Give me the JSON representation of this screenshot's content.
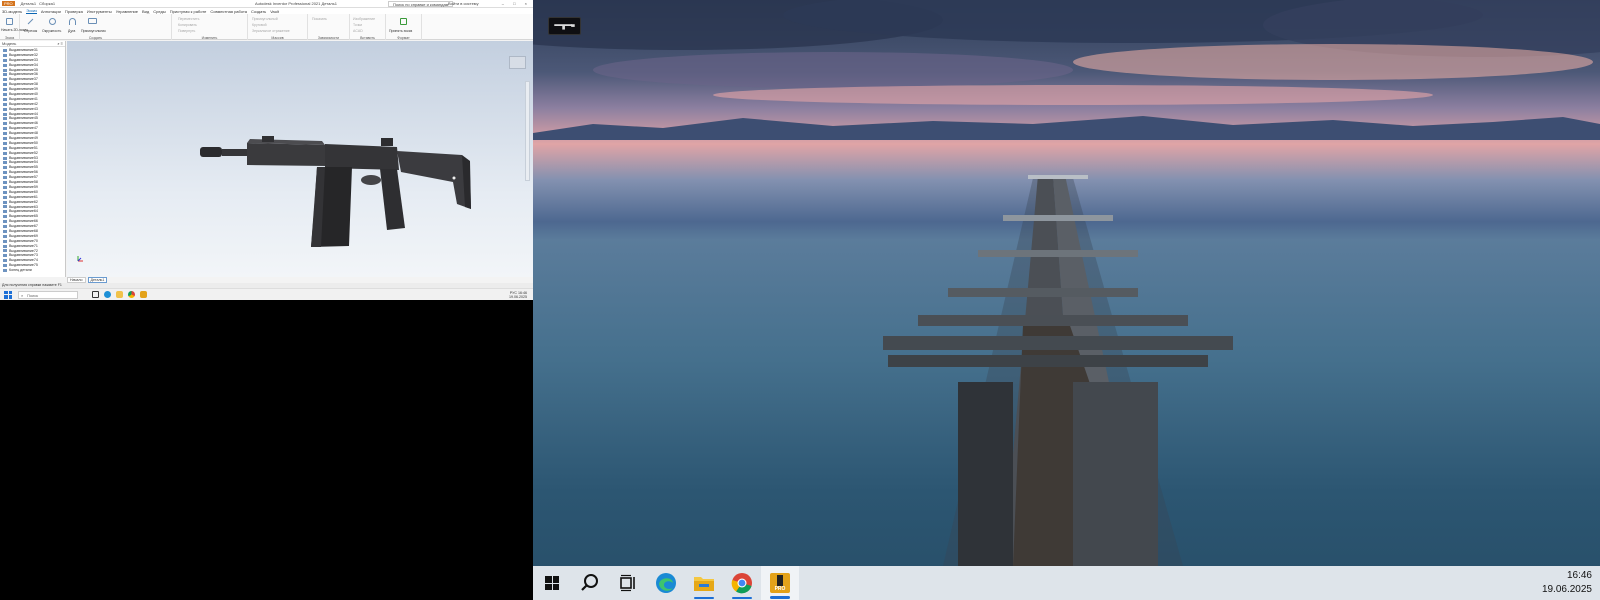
{
  "left_monitor": {
    "inventor": {
      "title_badge": "PRO",
      "title_tabs": [
        "Деталь1",
        "Сборка1"
      ],
      "title_center": "Autodesk Inventor Professional 2021   Деталь1",
      "search_placeholder": "Поиск по справке и командам",
      "user": "Войти в систему",
      "window_controls": "– □ ×",
      "ribbon_tabs": [
        "3D-модель",
        "Эскиз",
        "Аннотации",
        "Проверка",
        "Инструменты",
        "Управление",
        "Вид",
        "Среды",
        "Приступая к работе",
        "Совместная работа",
        "Создать",
        "Vault"
      ],
      "ribbon_active_tab": "Эскиз",
      "ribbon_groups": [
        {
          "label": "Эскиз",
          "buttons": [
            "Начать 2D-эскиз"
          ]
        },
        {
          "label": "Создать",
          "buttons": [
            "Отрезок",
            "Окружность",
            "Дуга",
            "Прямоугольник"
          ]
        },
        {
          "label": "Изменить",
          "buttons": [
            "Переместить",
            "Копировать",
            "Повернуть"
          ]
        },
        {
          "label": "Массив",
          "buttons": [
            "Прямоугольный",
            "Круговой",
            "Зеркальное отражение"
          ]
        },
        {
          "label": "Зависимости",
          "buttons": [
            "Показать"
          ]
        },
        {
          "label": "Вставить",
          "buttons": [
            "Изображение",
            "Точки",
            "ACAD"
          ]
        },
        {
          "label": "Формат",
          "buttons": [
            "Принять эскиз"
          ]
        }
      ],
      "browser_header": "Модель",
      "tree_items": [
        "Выдавливание31",
        "Выдавливание32",
        "Выдавливание33",
        "Выдавливание34",
        "Выдавливание35",
        "Выдавливание36",
        "Выдавливание37",
        "Выдавливание38",
        "Выдавливание39",
        "Выдавливание40",
        "Выдавливание41",
        "Выдавливание42",
        "Выдавливание43",
        "Выдавливание44",
        "Выдавливание45",
        "Выдавливание46",
        "Выдавливание47",
        "Выдавливание48",
        "Выдавливание49",
        "Выдавливание50",
        "Выдавливание51",
        "Выдавливание52",
        "Выдавливание53",
        "Выдавливание54",
        "Выдавливание55",
        "Выдавливание56",
        "Выдавливание57",
        "Выдавливание58",
        "Выдавливание59",
        "Выдавливание60",
        "Выдавливание61",
        "Выдавливание62",
        "Выдавливание63",
        "Выдавливание64",
        "Выдавливание65",
        "Выдавливание66",
        "Выдавливание67",
        "Выдавливание68",
        "Выдавливание69",
        "Выдавливание70",
        "Выдавливание71",
        "Выдавливание72",
        "Выдавливание73",
        "Выдавливание74",
        "Выдавливание75",
        "Конец детали"
      ],
      "bottom_tabs": [
        "Начало",
        "Деталь1"
      ],
      "status_text": "Для получения справки нажмите F1"
    },
    "taskbar": {
      "search_placeholder": "Поиск",
      "tray_lang": "РУС",
      "time": "16:46",
      "date": "19.06.2025"
    }
  },
  "right_monitor": {
    "taskbar": {
      "apps": [
        {
          "name": "start",
          "icon": "windows-logo-icon"
        },
        {
          "name": "search",
          "icon": "search-icon"
        },
        {
          "name": "task-view",
          "icon": "task-view-icon"
        },
        {
          "name": "edge",
          "icon": "edge-icon"
        },
        {
          "name": "file-explorer",
          "icon": "folder-icon"
        },
        {
          "name": "chrome",
          "icon": "chrome-icon"
        },
        {
          "name": "inventor",
          "icon": "inventor-pro-icon",
          "label": "PRO"
        }
      ],
      "time": "16:46",
      "date": "19.06.2025"
    }
  },
  "colors": {
    "inventor_accent": "#d4731c",
    "windows_accent": "#1d6fd6",
    "taskbar_bg": "#e8ecf1"
  }
}
